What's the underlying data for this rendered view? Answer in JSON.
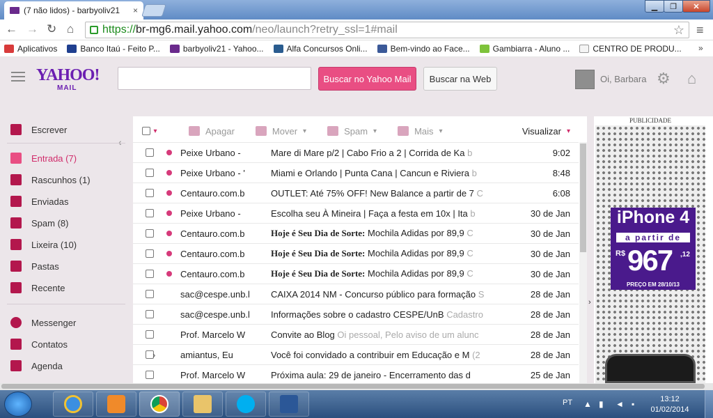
{
  "browser": {
    "tab_title": "(7 não lidos) - barbyoliv21",
    "tab_close": "×",
    "url_protocol": "https://",
    "url_host": "br-mg6.mail.yahoo.com",
    "url_path": "/neo/launch?retry_ssl=1#mail",
    "window_buttons": {
      "minimize": "▁",
      "maximize": "❐",
      "close": "✕"
    }
  },
  "bookmarks": [
    {
      "label": "Aplicativos",
      "color": "#d83b3b"
    },
    {
      "label": "Banco Itaú - Feito P...",
      "color": "#1f3f8f"
    },
    {
      "label": "barbyoliv21 - Yahoo...",
      "color": "#6a2a8c"
    },
    {
      "label": "Alfa Concursos Onli...",
      "color": "#2a5c8f"
    },
    {
      "label": "Bem-vindo ao Face...",
      "color": "#3b5998"
    },
    {
      "label": "Gambiarra - Aluno ...",
      "color": "#7ec33b"
    },
    {
      "label": "CENTRO DE PRODU...",
      "color": "#e8e8e8"
    }
  ],
  "bookmarks_more": "»",
  "yahoo": {
    "logo": "YAHOO!",
    "logo_sub": "MAIL",
    "search_button": "Buscar no Yahoo Mail",
    "web_button": "Buscar na Web",
    "greeting": "Oi, Barbara",
    "accent": "#e94e83"
  },
  "sidebar": {
    "compose": "Escrever",
    "folders": [
      {
        "label": "Entrada (7)",
        "icon": "envelope-icon"
      },
      {
        "label": "Rascunhos (1)",
        "icon": "drafts-icon"
      },
      {
        "label": "Enviadas",
        "icon": "send-icon"
      },
      {
        "label": "Spam (8)",
        "icon": "spam-icon"
      },
      {
        "label": "Lixeira (10)",
        "icon": "trash-icon"
      },
      {
        "label": "Pastas",
        "icon": "folder-icon"
      },
      {
        "label": "Recente",
        "icon": "recent-icon"
      }
    ],
    "apps": [
      {
        "label": "Messenger",
        "icon": "messenger-icon"
      },
      {
        "label": "Contatos",
        "icon": "contacts-icon"
      },
      {
        "label": "Agenda",
        "icon": "calendar-icon"
      }
    ]
  },
  "toolbar": {
    "delete": "Apagar",
    "move": "Mover",
    "spam": "Spam",
    "more": "Mais",
    "view": "Visualizar"
  },
  "emails": [
    {
      "from": "Peixe Urbano -",
      "subject": "Mare di Mare p/2 | Cabo Frio a 2 | Corrida de Ka",
      "snippet": "b",
      "date": "9:02",
      "unread": true,
      "bold_prefix": ""
    },
    {
      "from": "Peixe Urbano - '",
      "subject": "Miami e Orlando | Punta Cana | Cancun e Riviera",
      "snippet": "b",
      "date": "8:48",
      "unread": true,
      "bold_prefix": ""
    },
    {
      "from": "Centauro.com.b",
      "subject": "OUTLET: Até 75% OFF! New Balance a partir de 7",
      "snippet": "C",
      "date": "6:08",
      "unread": true,
      "bold_prefix": ""
    },
    {
      "from": "Peixe Urbano -",
      "subject": "Escolha seu À Mineira | Faça a festa em 10x | Ita",
      "snippet": "b",
      "date": "30 de Jan",
      "unread": true,
      "bold_prefix": ""
    },
    {
      "from": "Centauro.com.b",
      "subject": "Mochila Adidas por 89,9",
      "snippet": "C",
      "date": "30 de Jan",
      "unread": true,
      "bold_prefix": "Hoje é Seu Dia de Sorte:"
    },
    {
      "from": "Centauro.com.b",
      "subject": "Mochila Adidas por 89,9",
      "snippet": "C",
      "date": "30 de Jan",
      "unread": true,
      "bold_prefix": "Hoje é Seu Dia de Sorte:"
    },
    {
      "from": "Centauro.com.b",
      "subject": "Mochila Adidas por 89,9",
      "snippet": "C",
      "date": "30 de Jan",
      "unread": true,
      "bold_prefix": "Hoje é Seu Dia de Sorte:"
    },
    {
      "from": "sac@cespe.unb.l",
      "subject": "CAIXA 2014 NM - Concurso público para formação",
      "snippet": "S",
      "date": "28 de Jan",
      "unread": false,
      "bold_prefix": ""
    },
    {
      "from": "sac@cespe.unb.l",
      "subject": "Informações sobre o cadastro CESPE/UnB",
      "snippet": "Cadastro",
      "date": "28 de Jan",
      "unread": false,
      "bold_prefix": ""
    },
    {
      "from": "Prof. Marcelo W",
      "subject": "Convite ao Blog",
      "snippet": "Oi pessoal, Pelo aviso de um alunc",
      "date": "28 de Jan",
      "unread": false,
      "bold_prefix": ""
    },
    {
      "from": "amiantus, Eu",
      "subject": "Você foi convidado a contribuir em Educação e M",
      "snippet": "(2",
      "date": "28 de Jan",
      "unread": false,
      "bold_prefix": "",
      "arrow": "›"
    },
    {
      "from": "Prof. Marcelo W",
      "subject": "Próxima aula: 29 de janeiro - Encerramento das d",
      "snippet": "",
      "date": "25 de Jan",
      "unread": false,
      "bold_prefix": ""
    }
  ],
  "ad": {
    "label": "PUBLICIDADE",
    "title": "iPhone 4",
    "subtitle": "a partir de",
    "currency": "R$",
    "price": "967",
    "cents": ",12",
    "date_note": "PREÇO EM 28/10/13"
  },
  "taskbar": {
    "language": "PT",
    "time": "13:12",
    "date": "01/02/2014"
  }
}
